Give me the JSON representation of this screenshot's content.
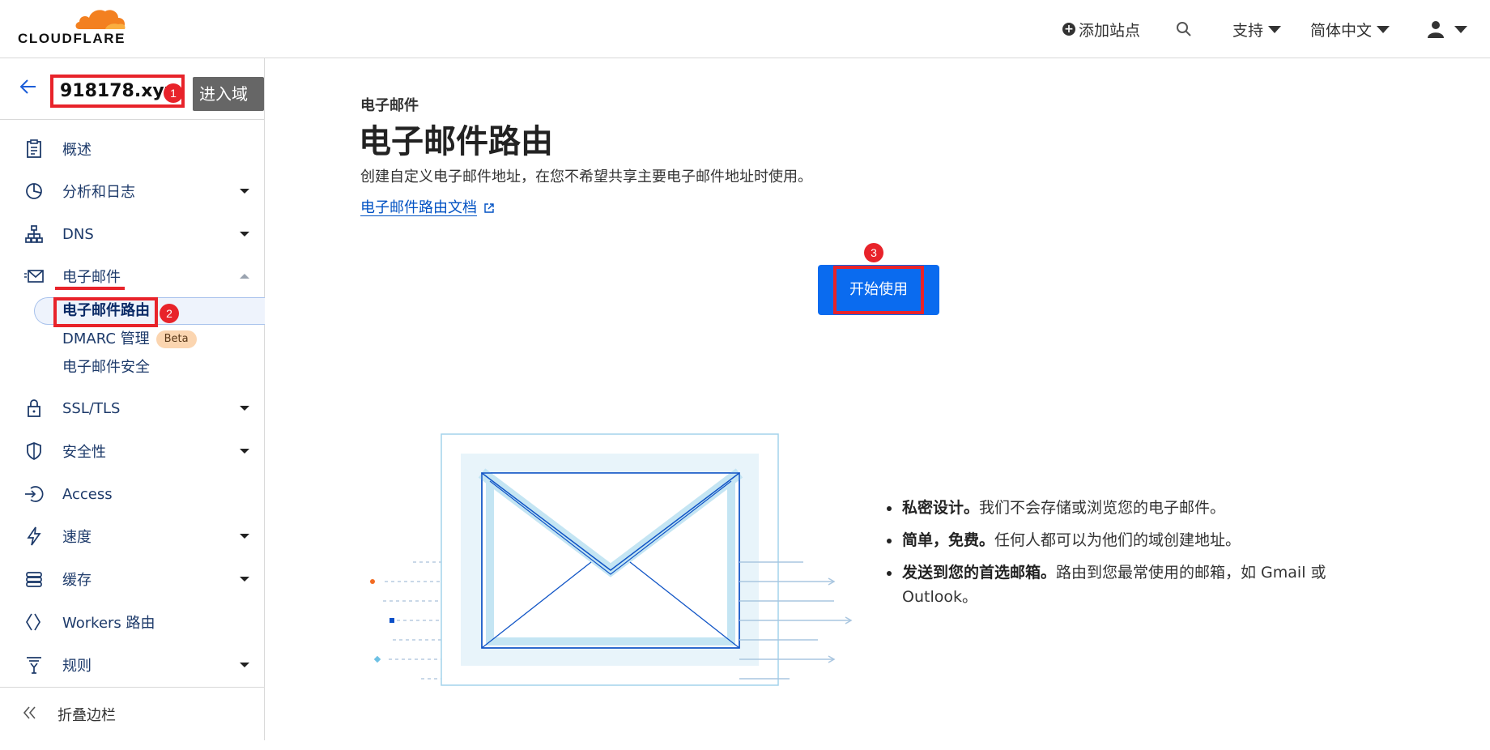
{
  "brand": {
    "logo_text": "CLOUDFLARE",
    "cloud_color": "#f38020"
  },
  "topnav": {
    "add_site": "添加站点",
    "support": "支持",
    "language": "简体中文"
  },
  "sidebar": {
    "domain": "918178.xyz",
    "tooltip": "进入域名下",
    "steps": [
      "1",
      "2",
      "3"
    ],
    "items": [
      {
        "label": "概述"
      },
      {
        "label": "分析和日志"
      },
      {
        "label": "DNS"
      },
      {
        "label": "电子邮件"
      },
      {
        "label": "SSL/TLS"
      },
      {
        "label": "安全性"
      },
      {
        "label": "Access"
      },
      {
        "label": "速度"
      },
      {
        "label": "缓存"
      },
      {
        "label": "Workers 路由"
      },
      {
        "label": "规则"
      }
    ],
    "email_sub": [
      {
        "label": "电子邮件路由"
      },
      {
        "label": "DMARC 管理",
        "badge": "Beta"
      },
      {
        "label": "电子邮件安全"
      }
    ],
    "collapse": "折叠边栏"
  },
  "main": {
    "eyebrow": "电子邮件",
    "title": "电子邮件路由",
    "description": "创建自定义电子邮件地址，在您不希望共享主要电子邮件地址时使用。",
    "doc_link": "电子邮件路由文档",
    "start_button": "开始使用",
    "bullets": [
      {
        "bold": "私密设计。",
        "text": "我们不会存储或浏览您的电子邮件。"
      },
      {
        "bold": "简单，免费。",
        "text": "任何人都可以为他们的域创建地址。"
      },
      {
        "bold": "发送到您的首选邮箱。",
        "text": "路由到您最常使用的邮箱，如 Gmail 或 Outlook。"
      }
    ]
  },
  "colors": {
    "accent": "#0a6bef",
    "annotation": "#e8232a",
    "link": "#0051c3",
    "nav_text": "#1d3a6a"
  }
}
